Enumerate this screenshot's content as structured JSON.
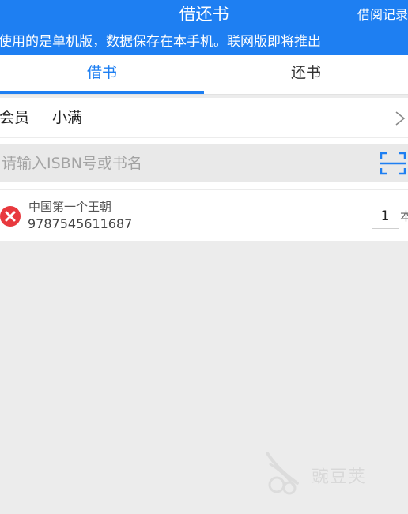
{
  "header": {
    "title": "借还书",
    "records_link": "借阅记录"
  },
  "notice": "使用的是单机版，数据保存在本手机。联网版即将推出",
  "tabs": [
    {
      "label": "借书",
      "active": true
    },
    {
      "label": "还书",
      "active": false
    }
  ],
  "member": {
    "label": "会员",
    "name": "小满"
  },
  "search": {
    "placeholder": "请输入ISBN号或书名",
    "value": ""
  },
  "books": [
    {
      "title": "中国第一个王朝",
      "isbn": "9787545611687",
      "quantity": "1",
      "unit": "本"
    }
  ],
  "watermark": "豌豆荚",
  "colors": {
    "accent": "#1e7ff2",
    "remove": "#e8393e",
    "background": "#ececec"
  }
}
